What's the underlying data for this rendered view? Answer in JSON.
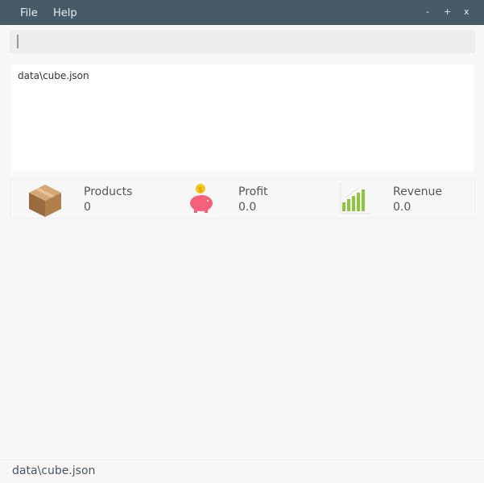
{
  "menu": {
    "file": "File",
    "help": "Help"
  },
  "window_controls": {
    "minimize": "-",
    "maximize": "+",
    "close": "x"
  },
  "command_input": {
    "value": ""
  },
  "output": {
    "text": "data\\cube.json"
  },
  "stats": [
    {
      "label": "Products",
      "value": "0",
      "icon": "box-icon"
    },
    {
      "label": "Profit",
      "value": "0.0",
      "icon": "piggy-bank-icon"
    },
    {
      "label": "Revenue",
      "value": "0.0",
      "icon": "bar-chart-icon"
    }
  ],
  "status_bar": {
    "text": "data\\cube.json"
  }
}
